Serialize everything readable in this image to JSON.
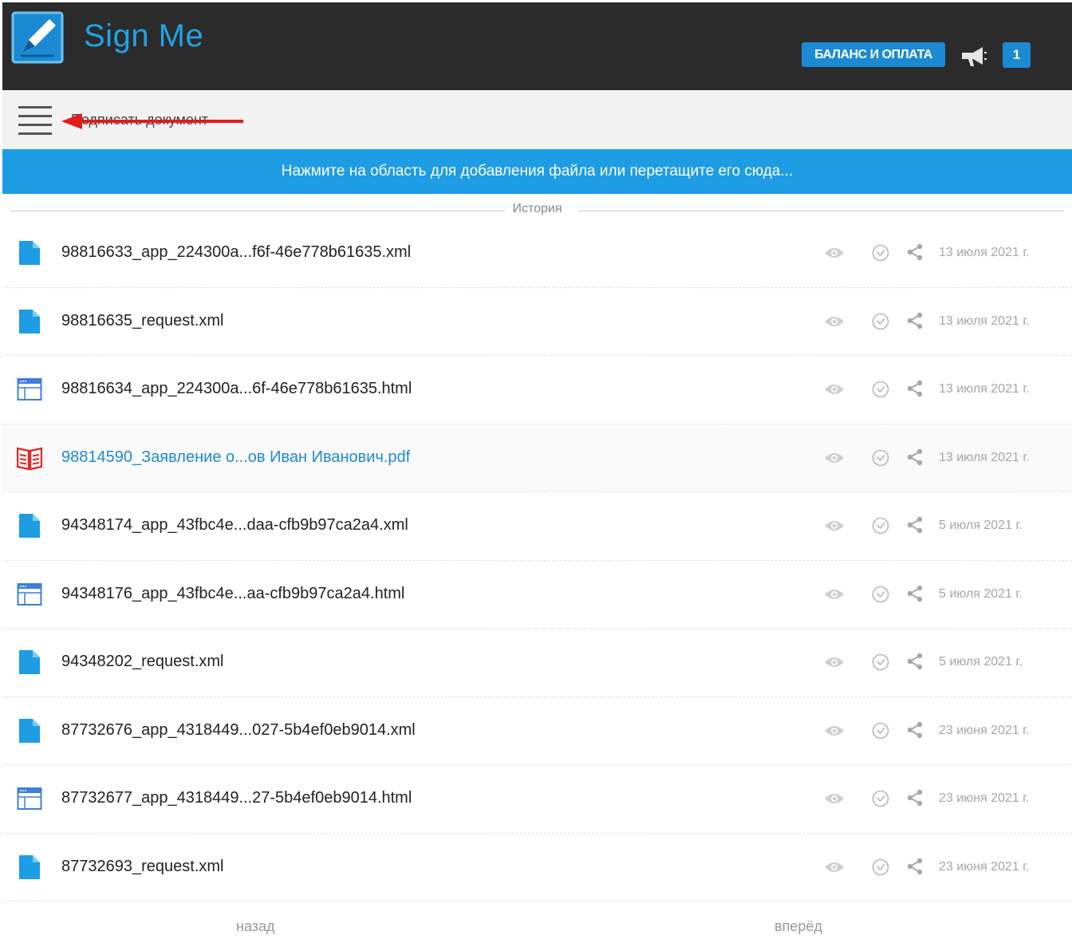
{
  "header": {
    "brand": "Sign Me",
    "balance_button": "БАЛАНС И ОПЛАТА",
    "notification_count": "1",
    "accent_color": "#1b8ad3"
  },
  "toolbar": {
    "menu_label": "Подписать документ"
  },
  "dropzone": {
    "text": "Нажмите на область для добавления файла или перетащите его сюда..."
  },
  "history": {
    "label": "История"
  },
  "files": [
    {
      "icon": "xml-file-icon",
      "name": "98816633_app_224300a...f6f-46e778b61635.xml",
      "date": "13 июля 2021 г."
    },
    {
      "icon": "xml-file-icon",
      "name": "98816635_request.xml",
      "date": "13 июля 2021 г."
    },
    {
      "icon": "html-file-icon",
      "name": "98816634_app_224300a...6f-46e778b61635.html",
      "date": "13 июля 2021 г."
    },
    {
      "icon": "pdf-file-icon",
      "name": "98814590_Заявление о...ов Иван Иванович.pdf",
      "date": "13 июля 2021 г."
    },
    {
      "icon": "xml-file-icon",
      "name": "94348174_app_43fbc4e...daa-cfb9b97ca2a4.xml",
      "date": "5 июля 2021 г."
    },
    {
      "icon": "html-file-icon",
      "name": "94348176_app_43fbc4e...aa-cfb9b97ca2a4.html",
      "date": "5 июля 2021 г."
    },
    {
      "icon": "xml-file-icon",
      "name": "94348202_request.xml",
      "date": "5 июля 2021 г."
    },
    {
      "icon": "xml-file-icon",
      "name": "87732676_app_4318449...027-5b4ef0eb9014.xml",
      "date": "23 июня 2021 г."
    },
    {
      "icon": "html-file-icon",
      "name": "87732677_app_4318449...27-5b4ef0eb9014.html",
      "date": "23 июня 2021 г."
    },
    {
      "icon": "xml-file-icon",
      "name": "87732693_request.xml",
      "date": "23 июня 2021 г."
    }
  ],
  "pagination": {
    "prev": "назад",
    "next": "вперёд"
  }
}
